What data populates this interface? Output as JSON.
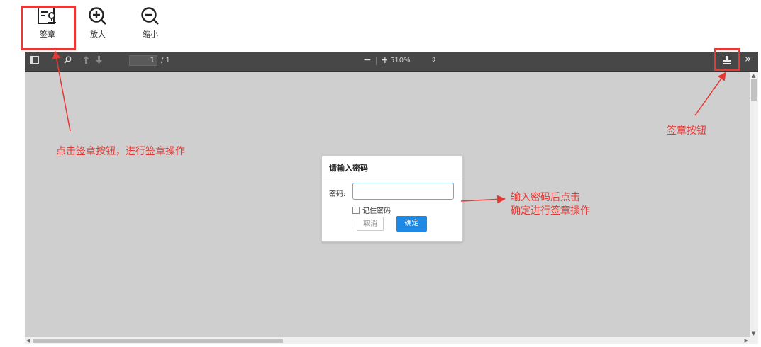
{
  "toolbar": {
    "sign_label": "签章",
    "zoom_in_label": "放大",
    "zoom_out_label": "缩小"
  },
  "viewer": {
    "page_current": "1",
    "page_total": "/ 1",
    "zoom_minus": "−",
    "zoom_plus": "+",
    "zoom_value": "510%",
    "more_icon": "»"
  },
  "dialog": {
    "title": "请输入密码",
    "password_label": "密码:",
    "password_value": "",
    "remember_label": "记住密码",
    "cancel_label": "取消",
    "ok_label": "确定"
  },
  "annotations": {
    "left_note": "点击签章按钮，进行签章操作",
    "right_note": "签章按钮",
    "dialog_note_line1": "输入密码后点击",
    "dialog_note_line2": "确定进行签章操作"
  },
  "colors": {
    "annotation": "#e53935",
    "ok_button": "#1e88e5",
    "viewer_toolbar": "#474747",
    "document_bg": "#cfcfcf"
  }
}
